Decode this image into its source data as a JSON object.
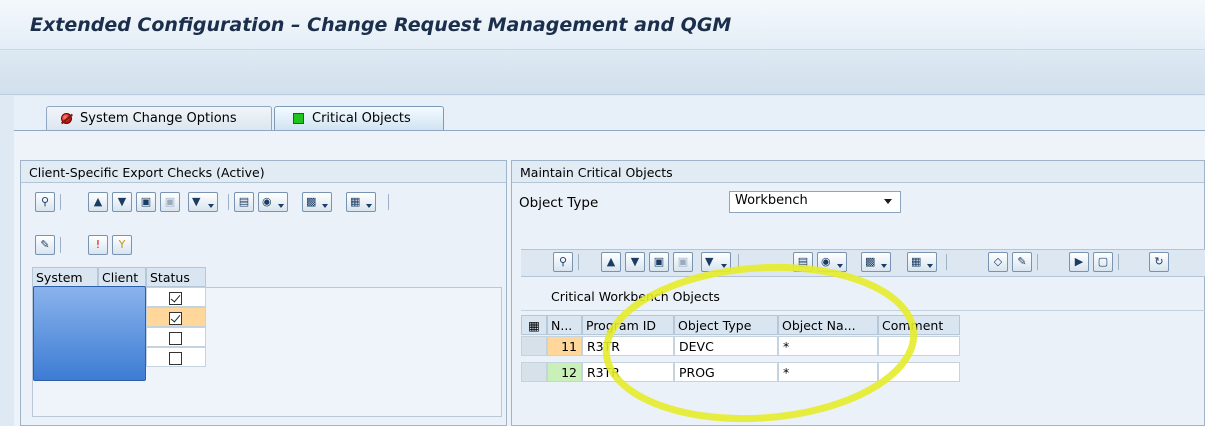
{
  "app": {
    "title": "Extended Configuration – Change Request Management and QGM"
  },
  "tabs": [
    {
      "label": "System Change Options",
      "status_icon": "red-status-icon",
      "active": false
    },
    {
      "label": "Critical Objects",
      "status_icon": "green-status-icon",
      "active": true
    }
  ],
  "left_panel": {
    "title": "Client-Specific Export Checks (Active)",
    "columns": [
      "System",
      "Client",
      "Status"
    ],
    "rows": [
      {
        "status": true,
        "selected": false
      },
      {
        "status": true,
        "selected": true
      },
      {
        "status": false,
        "selected": false
      },
      {
        "status": false,
        "selected": false
      }
    ]
  },
  "right_panel": {
    "title": "Maintain Critical Objects",
    "object_type_label": "Object Type",
    "object_type_value": "Workbench",
    "grid_title": "Critical Workbench Objects",
    "columns": [
      "N...",
      "Program ID",
      "Object Type",
      "Object Na...",
      "Comment"
    ],
    "rows": [
      {
        "n": "11",
        "program_id": "R3TR",
        "object_type": "DEVC",
        "object_name": "*",
        "comment": ""
      },
      {
        "n": "12",
        "program_id": "R3TR",
        "object_type": "PROG",
        "object_name": "*",
        "comment": ""
      }
    ]
  },
  "colors": {
    "annotation": "#e6ec2a",
    "row_highlight_orange": "#ffd79a",
    "row_highlight_green": "#c9f0b8",
    "blurred_block": "#4a86d8"
  }
}
